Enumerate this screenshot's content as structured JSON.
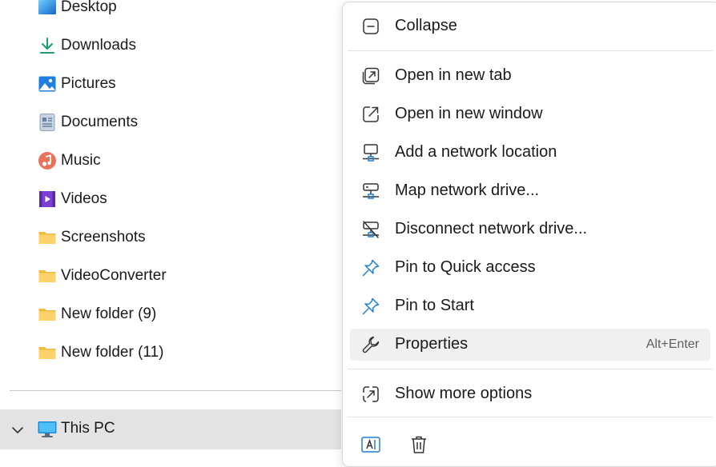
{
  "nav": {
    "items": [
      {
        "label": "Desktop",
        "icon": "desktop-icon"
      },
      {
        "label": "Downloads",
        "icon": "download-icon"
      },
      {
        "label": "Pictures",
        "icon": "pictures-icon"
      },
      {
        "label": "Documents",
        "icon": "documents-icon"
      },
      {
        "label": "Music",
        "icon": "music-icon"
      },
      {
        "label": "Videos",
        "icon": "videos-icon"
      },
      {
        "label": "Screenshots",
        "icon": "folder-icon"
      },
      {
        "label": "VideoConverter",
        "icon": "folder-icon"
      },
      {
        "label": "New folder (9)",
        "icon": "folder-icon"
      },
      {
        "label": "New folder (11)",
        "icon": "folder-icon"
      }
    ],
    "this_pc": {
      "label": "This PC",
      "icon": "computer-icon",
      "expanded": true
    }
  },
  "context_menu": {
    "collapse": "Collapse",
    "items": [
      {
        "label": "Open in new tab",
        "icon": "open-new-tab-icon"
      },
      {
        "label": "Open in new window",
        "icon": "open-new-window-icon"
      },
      {
        "label": "Add a network location",
        "icon": "network-location-icon"
      },
      {
        "label": "Map network drive...",
        "icon": "map-drive-icon"
      },
      {
        "label": "Disconnect network drive...",
        "icon": "disconnect-drive-icon"
      },
      {
        "label": "Pin to Quick access",
        "icon": "pin-icon"
      },
      {
        "label": "Pin to Start",
        "icon": "pin-icon"
      },
      {
        "label": "Properties",
        "icon": "wrench-icon",
        "shortcut": "Alt+Enter",
        "highlighted": true
      }
    ],
    "show_more": "Show more options",
    "bottom_icons": [
      "rename-icon",
      "delete-icon"
    ]
  },
  "colors": {
    "accent": "#1e7fd4",
    "folder": "#f7c948",
    "selection": "#e3e3e3",
    "menu_hover": "#f0f0f0"
  }
}
